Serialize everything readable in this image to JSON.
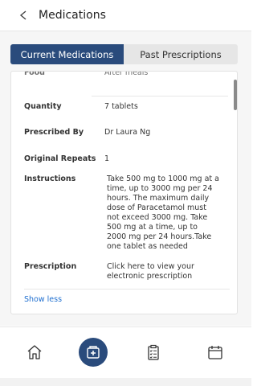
{
  "header": {
    "title": "Medications"
  },
  "tabs": [
    {
      "label": "Current Medications",
      "active": true
    },
    {
      "label": "Past Prescriptions",
      "active": false
    }
  ],
  "details": {
    "food": {
      "label": "Food",
      "value": "After meals"
    },
    "quantity": {
      "label": "Quantity",
      "value": "7 tablets"
    },
    "prescribed_by": {
      "label": "Prescribed By",
      "value": "Dr Laura Ng"
    },
    "original_repeats": {
      "label": "Original Repeats",
      "value": "1"
    },
    "instructions": {
      "label": "Instructions",
      "value": "Take 500 mg to 1000 mg at a time, up to 3000 mg per 24 hours. The maximum daily dose of Paracetamol must not exceed 3000 mg. Take 500 mg at a time, up to 2000 mg per 24 hours.Take one tablet as needed"
    },
    "prescription": {
      "label": "Prescription",
      "link": "Click here to view your electronic prescription"
    }
  },
  "show_less": "Show less",
  "bottom_nav": {
    "items": [
      {
        "name": "home",
        "icon": "home-icon"
      },
      {
        "name": "medications",
        "icon": "medications-icon"
      },
      {
        "name": "clipboard",
        "icon": "clipboard-icon"
      },
      {
        "name": "calendar",
        "icon": "calendar-icon"
      }
    ]
  },
  "colors": {
    "primary": "#2a4b7c",
    "link": "#1f6fd0"
  }
}
